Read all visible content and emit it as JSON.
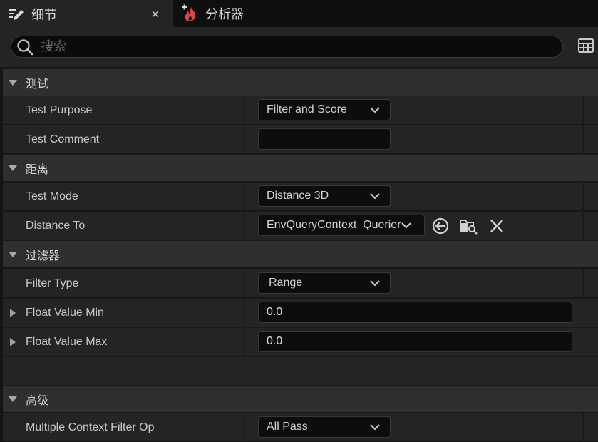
{
  "tabs": [
    {
      "label": "细节",
      "icon": "edit-details-icon",
      "active": true,
      "close_label": "×"
    },
    {
      "label": "分析器",
      "icon": "profiler-flame-icon",
      "active": false
    }
  ],
  "search": {
    "placeholder": "搜索",
    "value": ""
  },
  "sections": {
    "test": {
      "title": "测试"
    },
    "distance": {
      "title": "距离"
    },
    "filter": {
      "title": "过滤器"
    },
    "advanced": {
      "title": "高级"
    }
  },
  "rows": {
    "test_purpose": {
      "label": "Test Purpose",
      "value": "Filter and Score"
    },
    "test_comment": {
      "label": "Test Comment",
      "value": ""
    },
    "test_mode": {
      "label": "Test Mode",
      "value": "Distance 3D"
    },
    "distance_to": {
      "label": "Distance To",
      "value": "EnvQueryContext_Querier"
    },
    "filter_type": {
      "label": "Filter Type",
      "value": "Range"
    },
    "float_value_min": {
      "label": "Float Value Min",
      "value": "0.0"
    },
    "float_value_max": {
      "label": "Float Value Max",
      "value": "0.0"
    },
    "multiple_context_filter_op": {
      "label": "Multiple Context Filter Op",
      "value": "All Pass"
    }
  },
  "colors": {
    "accent_profiler": "#d9464a",
    "panel": "#242424",
    "section": "#2f2f2f",
    "input": "#0d0d0d"
  }
}
